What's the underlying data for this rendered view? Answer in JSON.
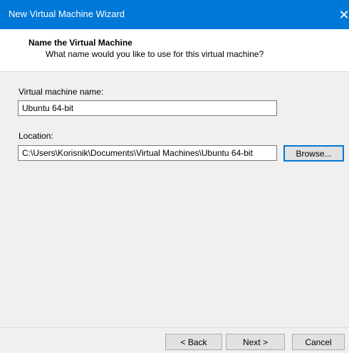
{
  "window": {
    "title": "New Virtual Machine Wizard",
    "close_glyph": "✕"
  },
  "header": {
    "title": "Name the Virtual Machine",
    "subtitle": "What name would you like to use for this virtual machine?"
  },
  "form": {
    "name_label": "Virtual machine name:",
    "name_value": "Ubuntu 64-bit",
    "location_label": "Location:",
    "location_value": "C:\\Users\\Korisnik\\Documents\\Virtual Machines\\Ubuntu 64-bit",
    "browse_label": "Browse..."
  },
  "footer": {
    "back_label": "< Back",
    "next_label": "Next >",
    "cancel_label": "Cancel"
  },
  "colors": {
    "titlebar": "#0078d7",
    "accent": "#0078d7"
  }
}
